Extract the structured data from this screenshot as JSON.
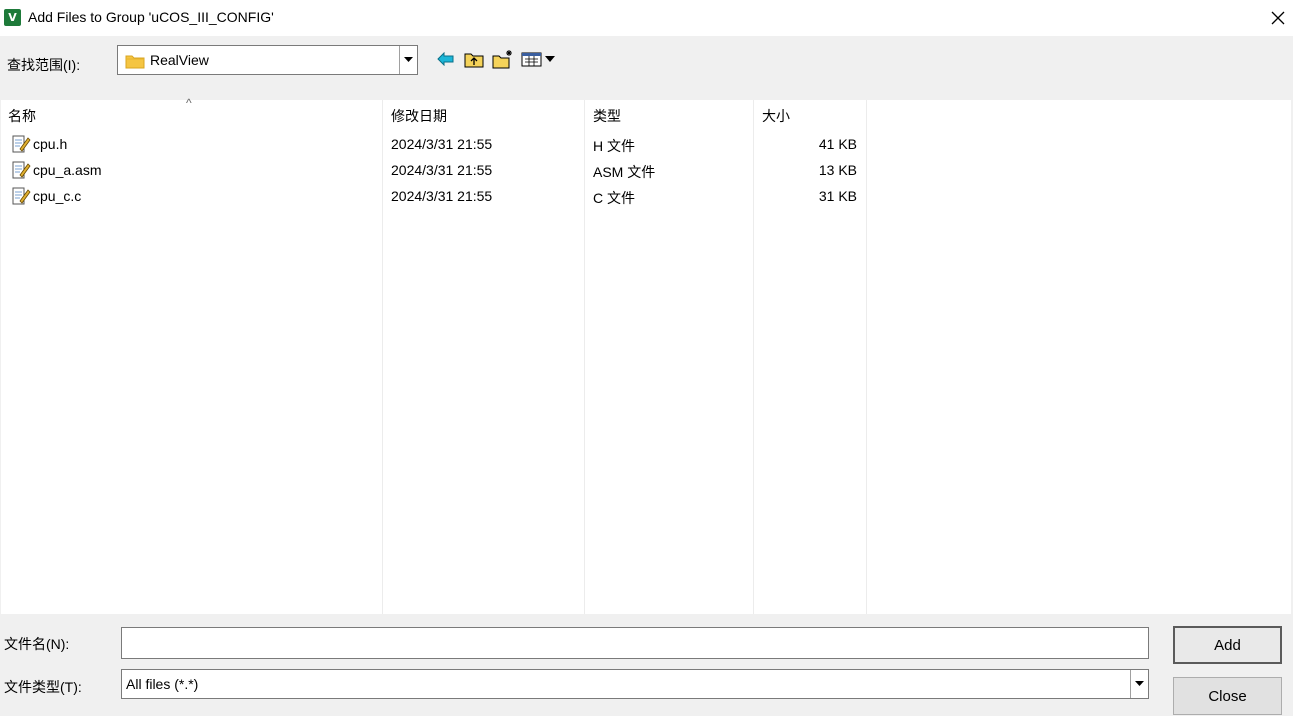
{
  "window": {
    "icon_label": "V",
    "title": "Add Files to Group 'uCOS_III_CONFIG'"
  },
  "toolbar": {
    "look_in_label": "查找范围(I):",
    "look_in_value": "RealView",
    "icons": [
      "back-icon",
      "up-folder-icon",
      "new-folder-icon",
      "view-menu-icon"
    ]
  },
  "list": {
    "columns": [
      "名称",
      "修改日期",
      "类型",
      "大小"
    ],
    "sort_indicator": "^",
    "rows": [
      {
        "name": "cpu.h",
        "date": "2024/3/31 21:55",
        "type": "H 文件",
        "size": "41 KB"
      },
      {
        "name": "cpu_a.asm",
        "date": "2024/3/31 21:55",
        "type": "ASM 文件",
        "size": "13 KB"
      },
      {
        "name": "cpu_c.c",
        "date": "2024/3/31 21:55",
        "type": "C 文件",
        "size": "31 KB"
      }
    ]
  },
  "bottom": {
    "file_name_label": "文件名(N):",
    "file_name_value": "",
    "file_type_label": "文件类型(T):",
    "file_type_value": "All files (*.*)",
    "add_label": "Add",
    "close_label": "Close"
  },
  "colors": {
    "app_icon": "#1e7a3a",
    "folder": "#f5c542",
    "back_arrow": "#0aa5c8"
  }
}
